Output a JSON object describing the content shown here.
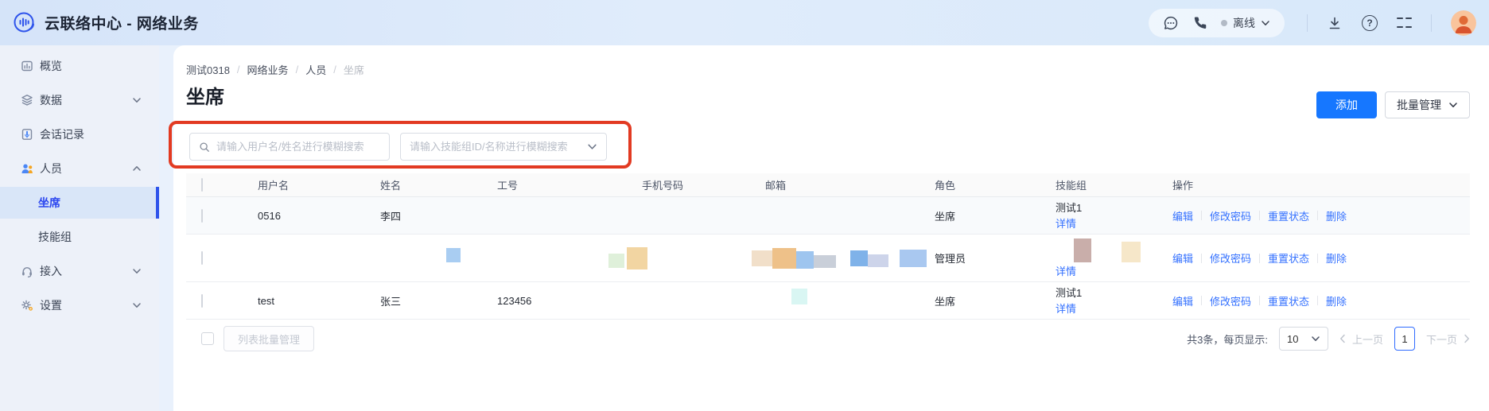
{
  "header": {
    "app_title": "云联络中心 - 网络业务",
    "status_label": "离线"
  },
  "sidebar": {
    "items": [
      {
        "label": "概览",
        "icon": "dashboard-icon"
      },
      {
        "label": "数据",
        "icon": "layers-icon"
      },
      {
        "label": "会话记录",
        "icon": "session-record-icon"
      },
      {
        "label": "人员",
        "icon": "people-icon"
      },
      {
        "label": "坐席"
      },
      {
        "label": "技能组"
      },
      {
        "label": "接入",
        "icon": "headset-icon"
      },
      {
        "label": "设置",
        "icon": "gear-icon"
      }
    ]
  },
  "breadcrumb": {
    "separator": "/",
    "items": [
      "测试0318",
      "网络业务",
      "人员",
      "坐席"
    ]
  },
  "page": {
    "title": "坐席",
    "add_button": "添加",
    "batch_button": "批量管理"
  },
  "filters": {
    "user_placeholder": "请输入用户名/姓名进行模糊搜索",
    "skill_placeholder": "请输入技能组ID/名称进行模糊搜索"
  },
  "table": {
    "columns": [
      "用户名",
      "姓名",
      "工号",
      "手机号码",
      "邮箱",
      "角色",
      "技能组",
      "操作"
    ],
    "actions": [
      "编辑",
      "修改密码",
      "重置状态",
      "删除"
    ],
    "detail_link": "详情",
    "rows": [
      {
        "username": "0516",
        "name": "李四",
        "employee_id": "",
        "phone": "",
        "email": "",
        "role": "坐席",
        "skill_group": "测试1"
      },
      {
        "username": "",
        "name": "",
        "employee_id": "",
        "phone": "",
        "email": "",
        "role": "管理员",
        "skill_group": ""
      },
      {
        "username": "test",
        "name": "张三",
        "employee_id": "123456",
        "phone": "",
        "email": "",
        "role": "坐席",
        "skill_group": "测试1"
      }
    ]
  },
  "footer": {
    "list_batch_button": "列表批量管理",
    "total_text": "共3条，每页显示:",
    "page_size": "10",
    "prev_label": "上一页",
    "current_page": "1",
    "next_label": "下一页"
  },
  "colors": {
    "primary": "#1677ff",
    "link": "#3370ff",
    "annotation_red": "#e23a22",
    "active_blue": "#2b46ef"
  }
}
